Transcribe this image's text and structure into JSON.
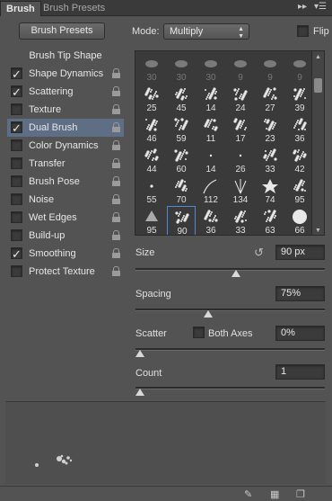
{
  "tabs": [
    {
      "label": "Brush",
      "active": true
    },
    {
      "label": "Brush Presets",
      "active": false
    }
  ],
  "header_icons": [
    "double-arrow-icon",
    "panel-menu-icon"
  ],
  "brush_presets_button": "Brush Presets",
  "mode": {
    "label": "Mode:",
    "value": "Multiply"
  },
  "flip": {
    "label": "Flip",
    "checked": false
  },
  "left_panel": {
    "heading": "Brush Tip Shape",
    "items": [
      {
        "label": "Shape Dynamics",
        "checked": true,
        "lock": true,
        "selected": false
      },
      {
        "label": "Scattering",
        "checked": true,
        "lock": true,
        "selected": false
      },
      {
        "label": "Texture",
        "checked": false,
        "lock": true,
        "selected": false
      },
      {
        "label": "Dual Brush",
        "checked": true,
        "lock": true,
        "selected": true
      },
      {
        "label": "Color Dynamics",
        "checked": false,
        "lock": true,
        "selected": false
      },
      {
        "label": "Transfer",
        "checked": false,
        "lock": true,
        "selected": false
      },
      {
        "label": "Brush Pose",
        "checked": false,
        "lock": true,
        "selected": false
      },
      {
        "label": "Noise",
        "checked": false,
        "lock": true,
        "selected": false
      },
      {
        "label": "Wet Edges",
        "checked": false,
        "lock": true,
        "selected": false
      },
      {
        "label": "Build-up",
        "checked": false,
        "lock": true,
        "selected": false
      },
      {
        "label": "Smoothing",
        "checked": true,
        "lock": true,
        "selected": false
      },
      {
        "label": "Protect Texture",
        "checked": false,
        "lock": true,
        "selected": false
      }
    ]
  },
  "brush_grid": {
    "rows": [
      [
        "30",
        "30",
        "30",
        "9",
        "9",
        "9"
      ],
      [
        "25",
        "45",
        "14",
        "24",
        "27",
        "39"
      ],
      [
        "46",
        "59",
        "11",
        "17",
        "23",
        "36"
      ],
      [
        "44",
        "60",
        "14",
        "26",
        "33",
        "42"
      ],
      [
        "55",
        "70",
        "112",
        "134",
        "74",
        "95"
      ],
      [
        "95",
        "90",
        "36",
        "33",
        "63",
        "66"
      ]
    ],
    "dimmed_rows": [
      0
    ],
    "selected": {
      "row": 5,
      "col": 1
    }
  },
  "size": {
    "label": "Size",
    "value": "90 px",
    "slider": 0.53
  },
  "spacing": {
    "label": "Spacing",
    "value": "75%",
    "slider": 0.38
  },
  "scatter": {
    "label": "Scatter",
    "both_axes_label": "Both Axes",
    "both_axes_checked": false,
    "value": "0%",
    "slider": 0.0
  },
  "count": {
    "label": "Count",
    "value": "1",
    "slider": 0.0
  },
  "bottom_icons": [
    "brush-tool-icon",
    "grid-icon",
    "new-preset-icon"
  ]
}
